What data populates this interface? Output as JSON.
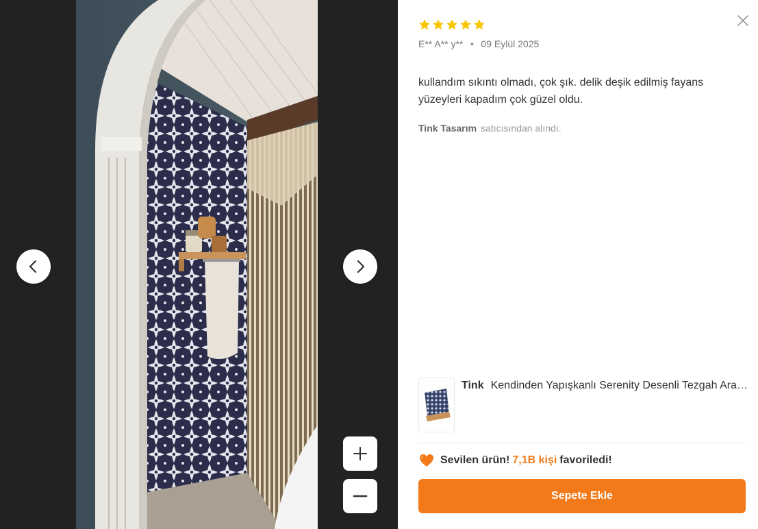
{
  "viewer": {
    "icons": {
      "prev": "chevron-left-icon",
      "next": "chevron-right-icon",
      "zoom_in": "plus-icon",
      "zoom_out": "minus-icon"
    }
  },
  "review": {
    "rating": 5,
    "max_rating": 5,
    "star_color": "#f8c600",
    "author": "E** A** y**",
    "date": "09 Eylül 2025",
    "comment": "kullandım sıkıntı olmadı, çok şık. delik deşik edilmiş fayans yüzeyleri kapadım çok güzel oldu.",
    "seller_name": "Tink Tasarım",
    "seller_suffix": "satıcısından alındı."
  },
  "product": {
    "brand": "Tink",
    "title": "Kendinden Yapışkanlı Serenity Desenli Tezgah Arası Mutfak Banyo Fayans Kaplama Folyosu"
  },
  "favorite": {
    "label": "Sevilen ürün!",
    "count": "7,1B kişi",
    "suffix": "favoriledi!",
    "icon": "heart-icon"
  },
  "actions": {
    "add_to_cart": "Sepete Ekle",
    "close_icon": "close-icon"
  },
  "colors": {
    "accent": "#f27a1a",
    "viewer_background": "#222222"
  }
}
